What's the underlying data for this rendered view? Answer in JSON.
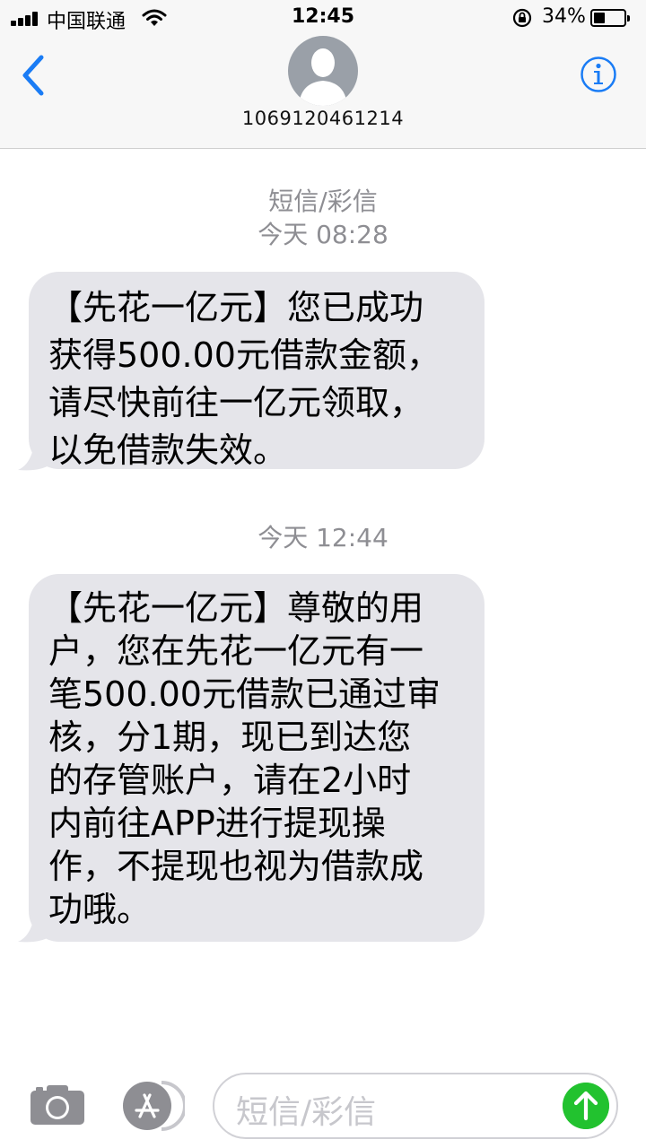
{
  "status_bar": {
    "carrier": "中国联通",
    "time": "12:45",
    "battery_percent": "34%",
    "icons": [
      "signal-icon",
      "wifi-icon",
      "orientation-lock-icon",
      "battery-icon"
    ]
  },
  "nav": {
    "back_icon": "chevron-left-icon",
    "contact_name": "1069120461214",
    "info_icon": "info-icon",
    "accent_color": "#1a7cf5"
  },
  "conversation": {
    "service_label": "短信/彩信",
    "groups": [
      {
        "timestamp": "今天 08:28",
        "message": "【先花一亿元】您已成功\n获得500.00元借款金额，\n请尽快前往一亿元领取，\n以免借款失效。"
      },
      {
        "timestamp": "今天 12:44",
        "message": "【先花一亿元】尊敬的用\n户，您在先花一亿元有一\n笔500.00元借款已通过审\n核，分1期，现已到达您\n的存管账户，请在2小时\n内前往APP进行提现操\n作，不提现也视为借款成\n功哦。"
      }
    ]
  },
  "composer": {
    "placeholder": "短信/彩信",
    "camera_icon": "camera-icon",
    "apps_icon": "app-store-icon",
    "send_icon": "send-arrow-icon",
    "send_color": "#22c22f"
  }
}
